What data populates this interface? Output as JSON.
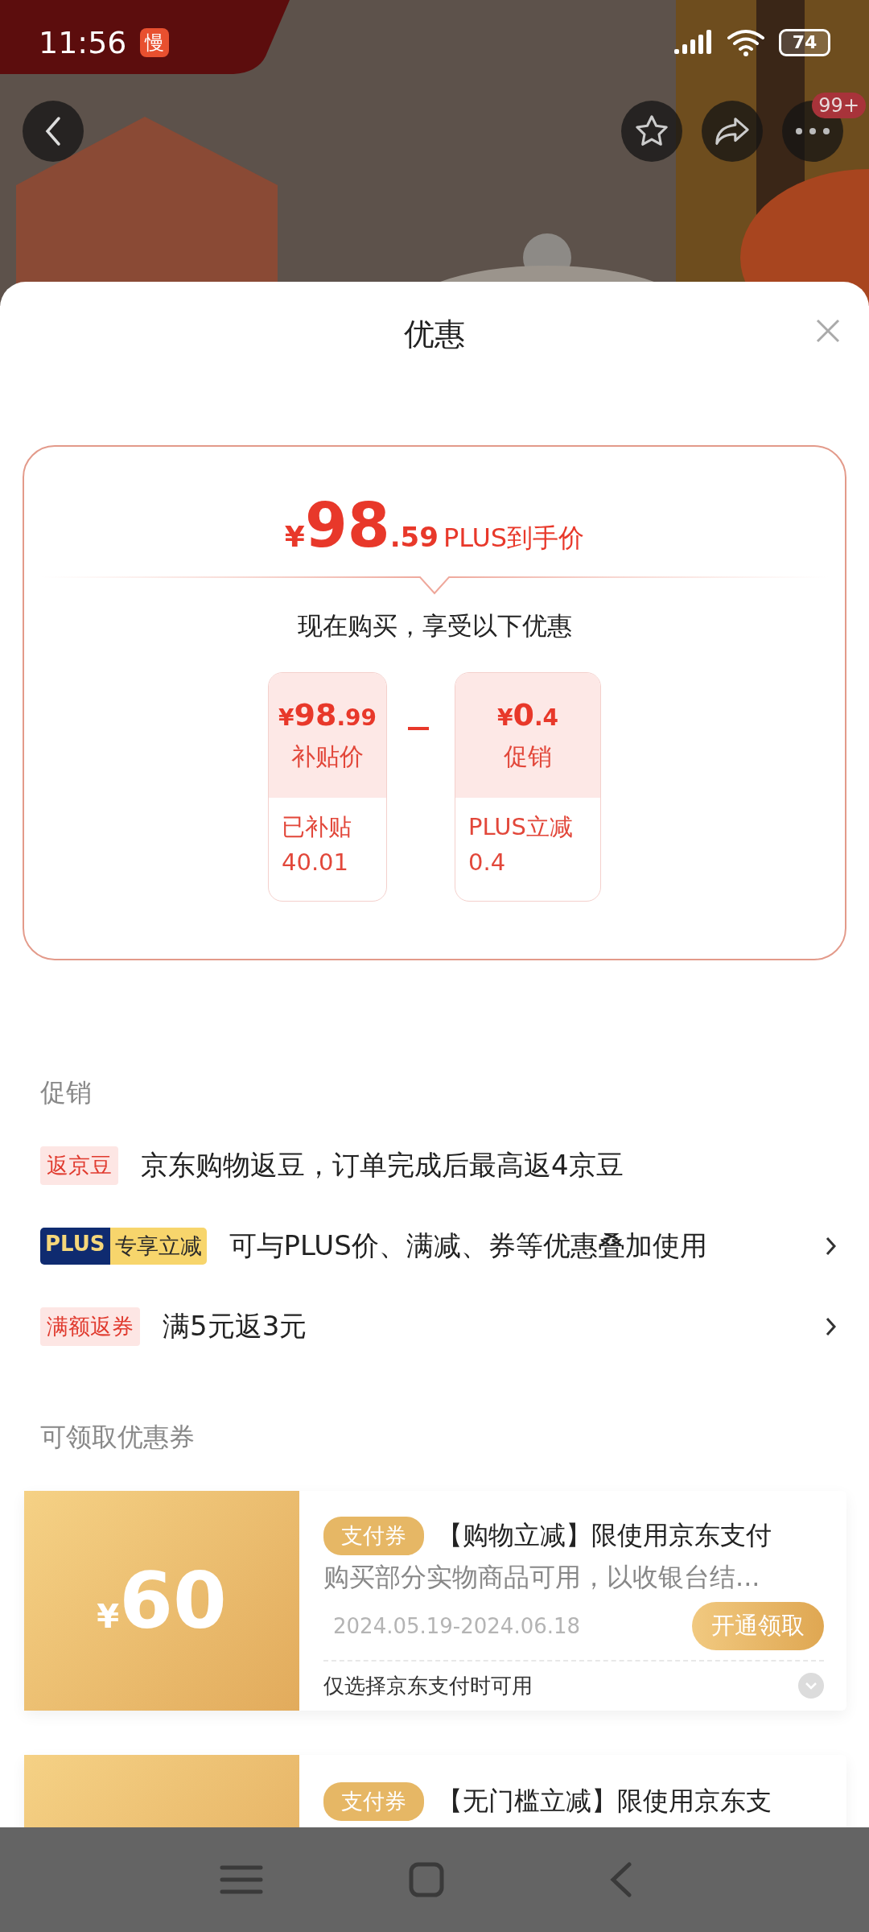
{
  "status_bar": {
    "time": "11:56",
    "notification": "慢",
    "battery": "74"
  },
  "header": {
    "kind": "picture",
    "badge": "99+"
  },
  "sheet": {
    "title": "优惠"
  },
  "price_card": {
    "currency": "¥",
    "price_int": "98",
    "price_dec": ".59",
    "price_label": "PLUS到手价",
    "subtitle": "现在购买，享受以下优惠",
    "breakdown": [
      {
        "currency": "¥",
        "int": "98",
        "dec": ".99",
        "label": "补贴价",
        "note_label": "已补贴",
        "note_value": "40.01"
      },
      {
        "currency": "¥",
        "int": "0",
        "dec": ".4",
        "label": "促销",
        "note_label": "PLUS立减",
        "note_value": "0.4"
      }
    ]
  },
  "promotions": {
    "heading": "促销",
    "items": [
      {
        "kind": "tag",
        "tag": "返京豆",
        "text": "京东购物返豆，订单完成后最高返4京豆",
        "has_arrow": false
      },
      {
        "kind": "plus",
        "tag": "PLUS",
        "tag_2": "专享立减",
        "text": "可与PLUS价、满减、券等优惠叠加使用",
        "has_arrow": true
      },
      {
        "kind": "tag",
        "tag": "满额返券",
        "text": "满5元返3元",
        "has_arrow": true
      }
    ]
  },
  "coupons": {
    "heading": "可领取优惠券",
    "items": [
      {
        "currency": "¥",
        "amount": "60",
        "tag": "支付券",
        "title": "【购物立减】限使用京东支付",
        "description": "购买部分实物商品可用，以收银台结...",
        "validity": "2024.05.19-2024.06.18",
        "button": "开通领取",
        "condition": "仅选择京东支付时可用",
        "expanded": false
      },
      {
        "tag": "支付券",
        "title": "【无门槛立减】限使用京东支"
      }
    ]
  }
}
